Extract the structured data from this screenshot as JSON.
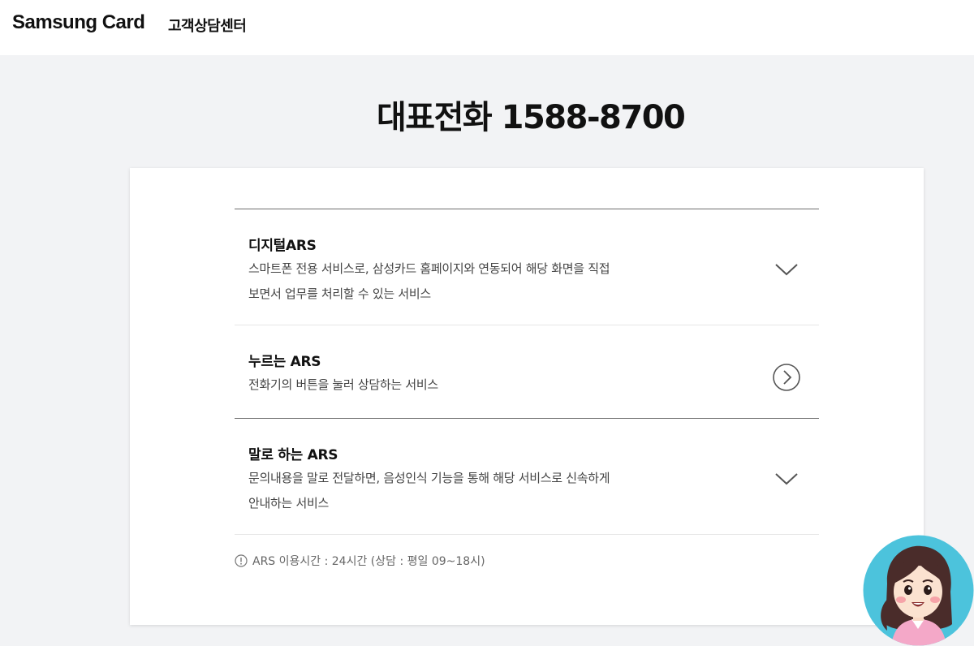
{
  "header": {
    "brand": "Samsung Card",
    "section": "고객상담센터"
  },
  "main": {
    "title": "대표전화 1588-8700",
    "items": [
      {
        "title": "디지털ARS",
        "desc_line1": "스마트폰 전용 서비스로, 삼성카드 홈페이지와 연동되어 해당 화면을 직접",
        "desc_line2": "보면서 업무를 처리할 수 있는 서비스",
        "icon": "chevron-down-icon"
      },
      {
        "title": "누르는 ARS",
        "desc_line1": "전화기의 버튼을 눌러 상담하는 서비스",
        "icon": "circle-arrow-right-icon"
      },
      {
        "title": "말로 하는 ARS",
        "desc_line1": "문의내용을 말로 전달하면, 음성인식 기능을 통해 해당 서비스로 신속하게",
        "desc_line2": "안내하는 서비스",
        "icon": "chevron-down-icon"
      }
    ],
    "notice": "ARS 이용시간 : 24시간 (상담 : 평일 09~18시)"
  },
  "colors": {
    "page_background": "#f2f3f5",
    "card_background": "#ffffff",
    "avatar_background": "#4cc3dc"
  }
}
